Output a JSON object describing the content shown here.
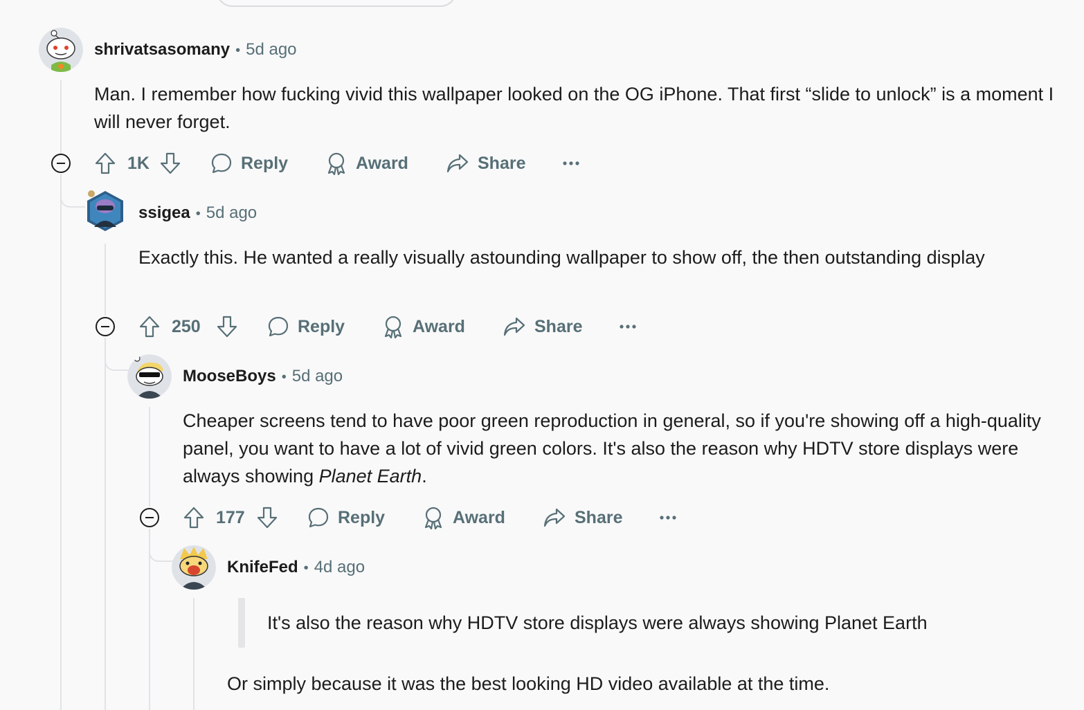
{
  "comments": [
    {
      "username": "shrivatsasomany",
      "time": "5d ago",
      "body": "Man. I remember how fucking vivid this wallpaper looked on the OG iPhone. That first “slide to unlock” is a moment I will never forget.",
      "votes": "1K",
      "reply_label": "Reply",
      "award_label": "Award",
      "share_label": "Share"
    },
    {
      "username": "ssigea",
      "time": "5d ago",
      "body": "Exactly this. He wanted a really visually astounding wallpaper to show off, the then outstanding display",
      "votes": "250",
      "reply_label": "Reply",
      "award_label": "Award",
      "share_label": "Share"
    },
    {
      "username": "MooseBoys",
      "time": "5d ago",
      "body_before": "Cheaper screens tend to have poor green reproduction in general, so if you're showing off a high-quality panel, you want to have a lot of vivid green colors. It's also the reason why HDTV store displays were always showing ",
      "body_italic": "Planet Earth",
      "body_after": ".",
      "votes": "177",
      "reply_label": "Reply",
      "award_label": "Award",
      "share_label": "Share"
    },
    {
      "username": "KnifeFed",
      "time": "4d ago",
      "quote": "It's also the reason why HDTV store displays were always showing Planet Earth",
      "body": "Or simply because it was the best looking HD video available at the time."
    }
  ],
  "icons": [
    "upvote-icon",
    "downvote-icon",
    "reply-icon",
    "award-icon",
    "share-icon",
    "more-icon",
    "collapse-icon"
  ],
  "colors": {
    "background": "#f9f9fa",
    "meta": "#576f76",
    "text": "#1c1c1c",
    "thread": "#e2e3e6"
  }
}
